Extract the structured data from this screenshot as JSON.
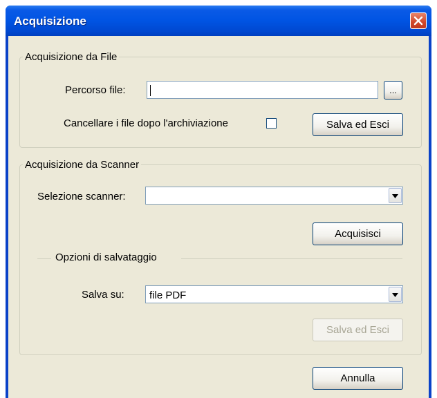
{
  "window": {
    "title": "Acquisizione"
  },
  "file_group": {
    "legend": "Acquisizione da File",
    "path_label": "Percorso file:",
    "path_value": "",
    "browse_label": "...",
    "delete_label": "Cancellare i file dopo l'archiviazione",
    "delete_checked": false,
    "save_label": "Salva ed Esci"
  },
  "scanner_group": {
    "legend": "Acquisizione da Scanner",
    "select_label": "Selezione scanner:",
    "select_value": "",
    "acquire_label": "Acquisisci",
    "options_legend": "Opzioni di salvataggio",
    "save_to_label": "Salva su:",
    "save_to_value": "file PDF",
    "save_label": "Salva ed Esci"
  },
  "footer": {
    "cancel_label": "Annulla"
  }
}
